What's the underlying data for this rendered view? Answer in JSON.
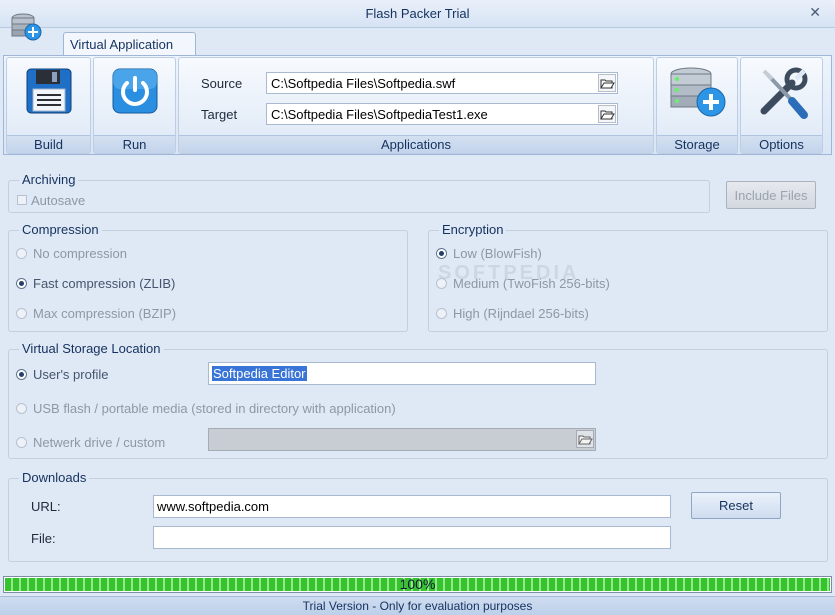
{
  "window": {
    "title": "Flash Packer Trial",
    "close_glyph": "✕"
  },
  "ribbon": {
    "tab": "Virtual Application",
    "groups": {
      "build": "Build",
      "run": "Run",
      "applications": "Applications",
      "storage": "Storage",
      "options": "Options"
    },
    "source_label": "Source",
    "source_value": "C:\\Softpedia Files\\Softpedia.swf",
    "target_label": "Target",
    "target_value": "C:\\Softpedia Files\\SoftpediaTest1.exe"
  },
  "archiving": {
    "title": "Archiving",
    "autosave_label": "Autosave",
    "autosave_checked": false,
    "include_files_label": "Include Files"
  },
  "compression": {
    "title": "Compression",
    "options": [
      "No compression",
      "Fast compression (ZLIB)",
      "Max compression (BZIP)"
    ],
    "selected": "Fast compression (ZLIB)"
  },
  "encryption": {
    "title": "Encryption",
    "options": [
      "Low (BlowFish)",
      "Medium (TwoFish 256-bits)",
      "High (Rijndael 256-bits)"
    ],
    "selected": "Low (BlowFish)"
  },
  "watermark": "SOFTPEDIA",
  "virtual_storage": {
    "title": "Virtual Storage Location",
    "options": [
      "User's profile",
      "USB flash / portable media (stored in directory with application)",
      "Netwerk drive / custom"
    ],
    "selected": "User's profile",
    "profile_value": "Softpedia Editor",
    "network_value": ""
  },
  "downloads": {
    "title": "Downloads",
    "url_label": "URL:",
    "url_value": "www.softpedia.com",
    "file_label": "File:",
    "file_value": "",
    "reset_label": "Reset"
  },
  "progress": {
    "percent": 100,
    "text": "100%"
  },
  "status": {
    "text": "Trial Version - Only for evaluation purposes"
  },
  "colors": {
    "accent": "#15325e",
    "progress_green": "#34c42e",
    "selection": "#3875d7"
  },
  "icons": {
    "app": "storage-stack-plus-icon",
    "build": "floppy-disk-icon",
    "run": "power-icon",
    "storage": "storage-stack-plus-icon",
    "options": "wrench-screwdriver-icon",
    "browse": "folder-open-icon"
  }
}
